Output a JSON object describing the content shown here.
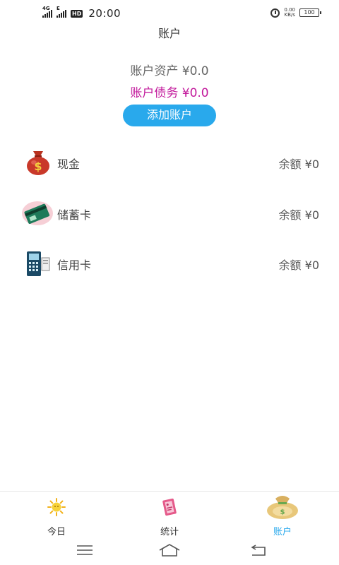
{
  "status_bar": {
    "network_1": "4G",
    "network_2": "E",
    "hd_badge": "HD",
    "time": "20:00",
    "net_speed_value": "0.00",
    "net_speed_unit": "KB/s",
    "battery": "100"
  },
  "header": {
    "title": "账户"
  },
  "summary": {
    "assets": "账户资产 ¥0.0",
    "debts": "账户债务 ¥0.0",
    "add_button": "添加账户",
    "debt_color": "#c2189b",
    "accent_color": "#29a9ec"
  },
  "accounts": [
    {
      "name": "现金",
      "balance": "余额 ¥0",
      "icon": "money-bag-icon"
    },
    {
      "name": "储蓄卡",
      "balance": "余额 ¥0",
      "icon": "savings-card-icon"
    },
    {
      "name": "信用卡",
      "balance": "余额 ¥0",
      "icon": "pos-terminal-icon"
    }
  ],
  "bottom_nav": {
    "items": [
      {
        "label": "今日",
        "icon": "sun-icon"
      },
      {
        "label": "统计",
        "icon": "notebook-icon"
      },
      {
        "label": "账户",
        "icon": "money-sack-icon",
        "active": true
      }
    ]
  },
  "system_nav": [
    "menu-icon",
    "home-icon",
    "back-icon"
  ]
}
